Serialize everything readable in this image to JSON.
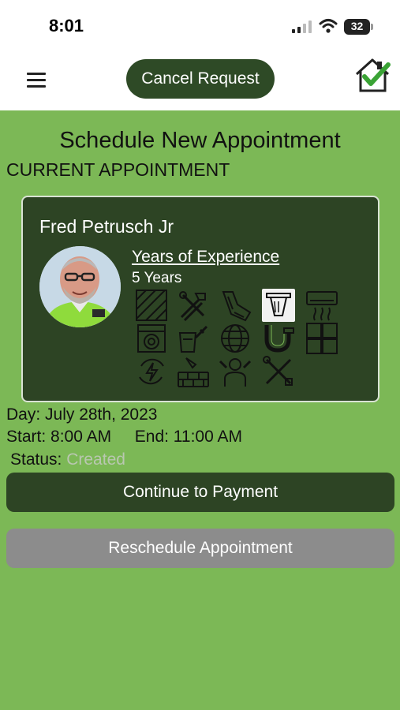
{
  "status_bar": {
    "time": "8:01",
    "battery": "32"
  },
  "header": {
    "cancel_label": "Cancel Request"
  },
  "page": {
    "title": "Schedule New Appointment",
    "subtitle": "CURRENT APPOINTMENT"
  },
  "technician": {
    "name": "Fred Petrusch Jr",
    "experience_label": "Years of Experience",
    "experience_value": "5 Years",
    "services": [
      {
        "icon": "flooring-icon",
        "selected": false
      },
      {
        "icon": "tools-icon",
        "selected": false
      },
      {
        "icon": "drywall-icon",
        "selected": false
      },
      {
        "icon": "light-fixture-icon",
        "selected": true
      },
      {
        "icon": "air-conditioner-icon",
        "selected": false
      },
      {
        "icon": "appliance-icon",
        "selected": false
      },
      {
        "icon": "painting-icon",
        "selected": false
      },
      {
        "icon": "globe-icon",
        "selected": false
      },
      {
        "icon": "plumbing-icon",
        "selected": false
      },
      {
        "icon": "tile-icon",
        "selected": false
      },
      {
        "icon": "electrical-icon",
        "selected": false
      },
      {
        "icon": "masonry-icon",
        "selected": false
      },
      {
        "icon": "handyman-icon",
        "selected": false
      },
      {
        "icon": "repair-icon",
        "selected": false
      }
    ]
  },
  "appointment": {
    "day": "Day: July 28th, 2023",
    "start": "Start: 8:00 AM",
    "end": "End: 11:00 AM",
    "status_label": "Status:",
    "status_value": "Created"
  },
  "buttons": {
    "pay": "Continue to Payment",
    "reschedule": "Reschedule Appointment"
  },
  "colors": {
    "background": "#7cb856",
    "card": "#2d4424",
    "button_dark": "#2e4a26",
    "button_disabled": "#8c8c8c"
  }
}
